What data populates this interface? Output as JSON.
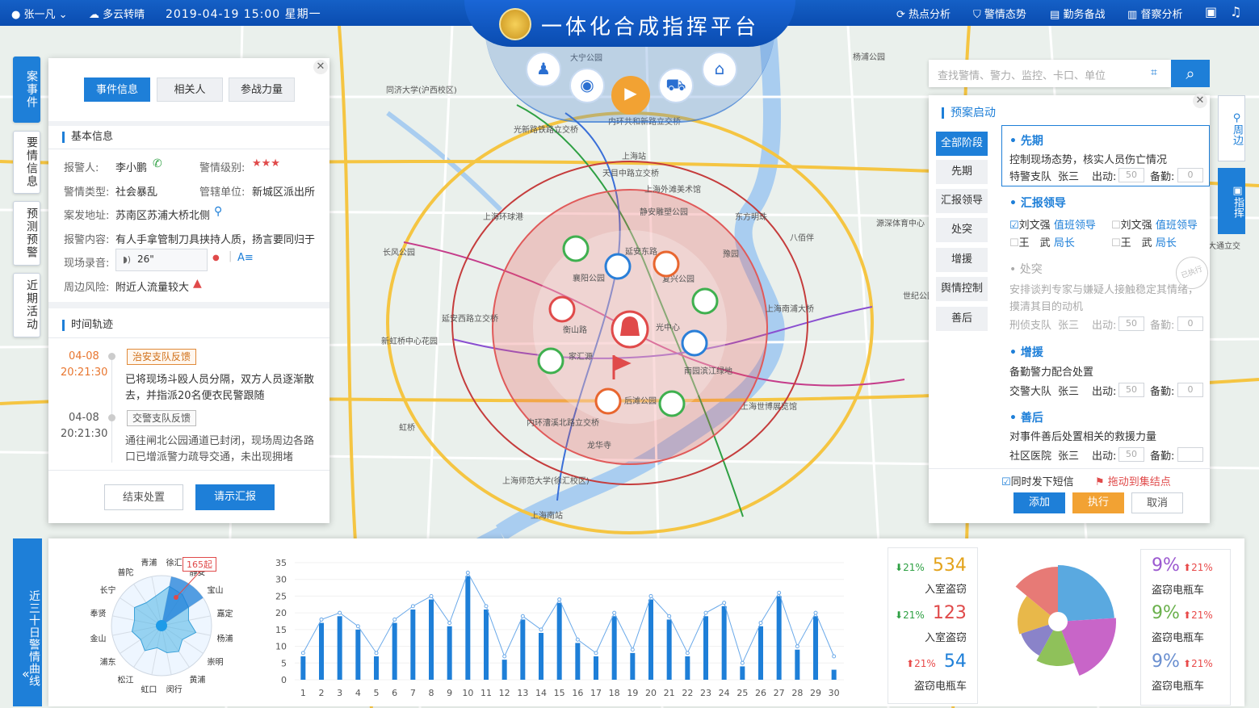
{
  "topbar": {
    "user": "张一凡",
    "weather": "多云转晴",
    "datetime": "2019-04-19 15:00 星期一",
    "title": "一体化合成指挥平台",
    "nav": [
      "热点分析",
      "警情态势",
      "勤务备战",
      "督察分析"
    ]
  },
  "left_tabs": [
    "案事件",
    "要情信息",
    "预测预警",
    "近期活动"
  ],
  "incident": {
    "tabs": [
      "事件信息",
      "相关人",
      "参战力量"
    ],
    "basic_title": "基本信息",
    "reporter_label": "报警人:",
    "reporter": "李小鹏",
    "level_label": "警情级别:",
    "level": "★★★",
    "type_label": "警情类型:",
    "type": "社会暴乱",
    "unit_label": "管辖单位:",
    "unit": "新城区派出所",
    "address_label": "案发地址:",
    "address": "苏南区苏浦大桥北侧",
    "content_label": "报警内容:",
    "content": "有人手拿管制刀具挟持人质，扬言要同归于",
    "recording_label": "现场录音:",
    "recording": "26\"",
    "risk_label": "周边风险:",
    "risk": "附近人流量较大",
    "timeline_title": "时间轨迹",
    "timeline": [
      {
        "date": "04-08",
        "time": "20:21:30",
        "tag": "治安支队反馈",
        "text1": "已将现场斗殴人员分隔，双方人员逐渐散",
        "text2": "去，并指派20名便衣民警跟随"
      },
      {
        "date": "04-08",
        "time": "20:21:30",
        "tag": "交警支队反馈",
        "text1": "通往闸北公园通道已封闭，现场周边各路",
        "text2": "口已增派警力疏导交通，未出现拥堵"
      }
    ],
    "btn_end": "结束处置",
    "btn_report": "请示汇报"
  },
  "search": {
    "placeholder": "查找警情、警力、监控、卡口、单位"
  },
  "plan": {
    "title": "预案启动",
    "stages": [
      "全部阶段",
      "先期",
      "汇报领导",
      "处突",
      "增援",
      "舆情控制",
      "善后"
    ],
    "out_label": "出动:",
    "standby_label": "备勤:",
    "items": {
      "s1_title": "先期",
      "s1_desc": "控制现场态势，核实人员伤亡情况",
      "s1_team": "特警支队",
      "s1_person": "张三",
      "s1_out": "50",
      "s1_standby": "0",
      "s2_title": "汇报领导",
      "s2_p1": "刘文强",
      "s2_p1r": "值班领导",
      "s2_p2": "刘文强",
      "s2_p2r": "值班领导",
      "s2_p3": "王　武",
      "s2_p3r": "局长",
      "s2_p4": "王　武",
      "s2_p4r": "局长",
      "s3_title": "处突",
      "s3_desc1": "安排谈判专家与嫌疑人接触稳定其情绪，",
      "s3_desc2": "摸清其目的动机",
      "s3_team": "刑侦支队",
      "s3_person": "张三",
      "s3_out": "50",
      "s3_standby": "0",
      "s3_stamp": "已执行",
      "s4_title": "增援",
      "s4_desc": "备勤警力配合处置",
      "s4_team": "交警大队",
      "s4_person": "张三",
      "s4_out": "50",
      "s4_standby": "0",
      "s5_title": "善后",
      "s5_desc": "对事件善后处置相关的救援力量",
      "s5_team": "社区医院",
      "s5_person": "张三",
      "s5_out": "50"
    },
    "sms": "同时发下短信",
    "drag": "拖动到集结点",
    "btn_add": "添加",
    "btn_exec": "执行",
    "btn_cancel": "取消"
  },
  "right_tabs": [
    "周边",
    "指挥"
  ],
  "map_labels": [
    "大宁公园",
    "同济大学(沪西校区)",
    "光新路铁路立交桥",
    "内环共和新路立交桥",
    "上海站",
    "天目中路立交桥",
    "上海外滩美术馆",
    "静安雕塑公园",
    "东方明珠",
    "上海环球港",
    "长风公园",
    "襄阳公园",
    "延安东路",
    "复兴公园",
    "豫园",
    "衡山路",
    "延安西路立交桥",
    "光中心",
    "上海南浦大桥",
    "新虹桥中心花园",
    "家汇源",
    "南园滨江绿地",
    "后滩公园",
    "内环漕溪北路立交桥",
    "龙华寺",
    "上海世博展览馆",
    "上海师范大学(徐汇校区)",
    "上海南站",
    "八佰伴",
    "虹桥",
    "源深体育中心",
    "世纪公园",
    "杨浦公园",
    "大通立交"
  ],
  "bottom": {
    "side_title": "近三十日警情曲线",
    "radar_labels": [
      "徐汇",
      "静安",
      "宝山",
      "嘉定",
      "杨浦",
      "崇明",
      "黄浦",
      "闵行",
      "虹口",
      "松江",
      "浦东",
      "金山",
      "奉贤",
      "长宁",
      "普陀",
      "青浦"
    ],
    "radar_callout": "165起",
    "stats": [
      {
        "pct": "21%",
        "value": "534",
        "label": "入室盗窃",
        "dir": "down"
      },
      {
        "pct": "21%",
        "value": "123",
        "label": "入室盗窃",
        "dir": "down"
      },
      {
        "pct": "21%",
        "value": "54",
        "label": "盗窃电瓶车",
        "dir": "up"
      }
    ],
    "stats2": [
      {
        "value": "9%",
        "pct": "21%",
        "label": "盗窃电瓶车"
      },
      {
        "value": "9%",
        "pct": "21%",
        "label": "盗窃电瓶车"
      },
      {
        "value": "9%",
        "pct": "21%",
        "label": "盗窃电瓶车"
      }
    ]
  },
  "chart_data": [
    {
      "type": "bar",
      "categories": [
        "1",
        "2",
        "3",
        "4",
        "5",
        "6",
        "7",
        "8",
        "9",
        "10",
        "11",
        "12",
        "13",
        "14",
        "15",
        "16",
        "17",
        "18",
        "19",
        "20",
        "21",
        "22",
        "23",
        "24",
        "25",
        "26",
        "27",
        "28",
        "29",
        "30"
      ],
      "series": [
        {
          "values": [
            7,
            17,
            19,
            15,
            7,
            17,
            21,
            24,
            16,
            31,
            21,
            6,
            18,
            14,
            23,
            11,
            7,
            19,
            8,
            24,
            18,
            7,
            19,
            22,
            4,
            16,
            25,
            9,
            19,
            3
          ]
        },
        {
          "values": [
            8,
            18,
            20,
            16,
            8,
            18,
            22,
            25,
            17,
            32,
            22,
            7,
            19,
            15,
            24,
            12,
            8,
            20,
            9,
            25,
            19,
            8,
            20,
            23,
            5,
            17,
            26,
            10,
            20,
            7
          ]
        }
      ],
      "ylim": [
        0,
        35
      ],
      "yticks": [
        "35",
        "30",
        "25",
        "20",
        "15",
        "10",
        "5",
        "0"
      ],
      "colors": {
        "bar": "#1e7fd8",
        "line": "#6aa9e9"
      }
    },
    {
      "type": "pie",
      "values": [
        24,
        20,
        14,
        12,
        16,
        14
      ],
      "colors": [
        "#5aa9e0",
        "#c865c8",
        "#8fc15a",
        "#8a83c9",
        "#e8b84a",
        "#e77a76"
      ]
    },
    {
      "type": "radar",
      "categories": [
        "徐汇",
        "静安",
        "宝山",
        "嘉定",
        "杨浦",
        "崇明",
        "黄浦",
        "闵行",
        "虹口",
        "松江",
        "浦东",
        "金山",
        "奉贤",
        "长宁",
        "普陀",
        "青浦"
      ],
      "values": [
        0.8,
        0.75,
        0.65,
        0.55,
        0.7,
        0.5,
        0.62,
        0.55,
        0.45,
        0.6,
        0.5,
        0.6,
        0.55,
        0.65,
        0.55,
        0.6
      ]
    }
  ]
}
